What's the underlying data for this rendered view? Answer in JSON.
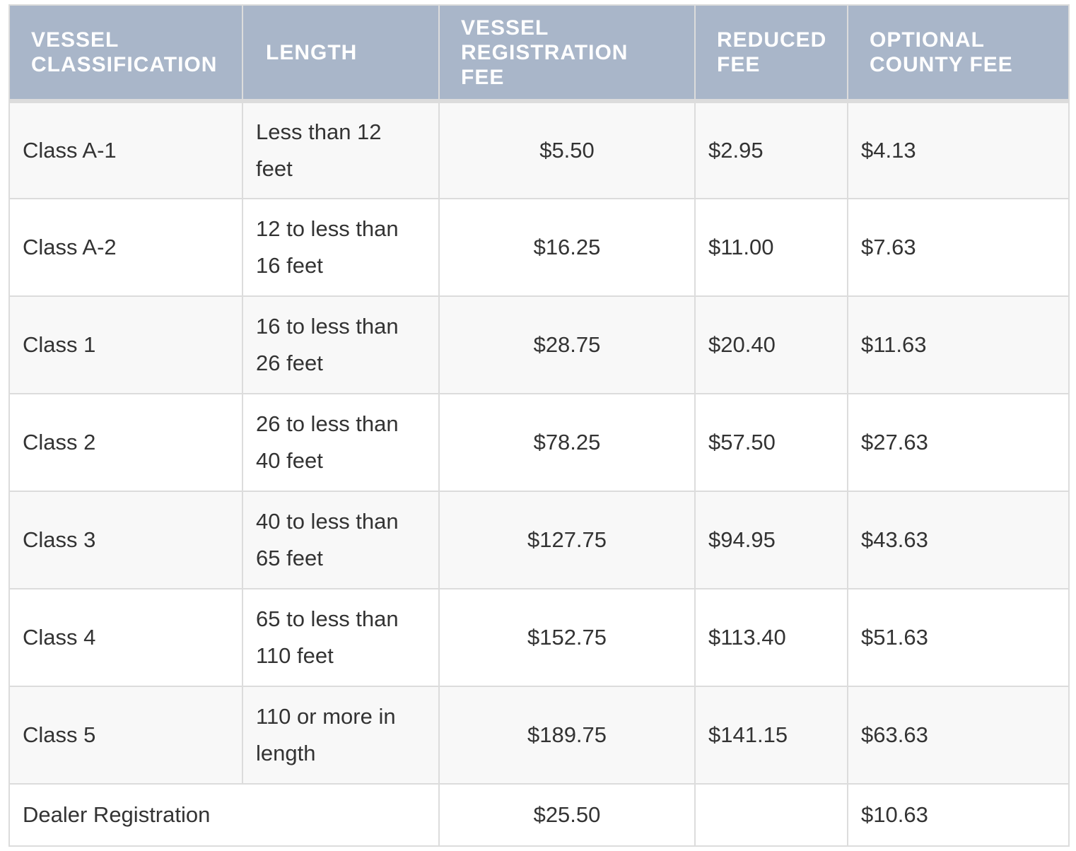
{
  "table": {
    "headers": {
      "classification": "VESSEL CLASSIFICATION",
      "length": "LENGTH",
      "registration_fee": "VESSEL REGISTRATION FEE",
      "reduced_fee": "REDUCED FEE",
      "county_fee": "OPTIONAL COUNTY FEE"
    },
    "rows": [
      {
        "classification": "Class A-1",
        "length": "Less than 12 feet",
        "registration_fee": "$5.50",
        "reduced_fee": "$2.95",
        "county_fee": "$4.13"
      },
      {
        "classification": "Class A-2",
        "length": "12 to less than 16 feet",
        "registration_fee": "$16.25",
        "reduced_fee": "$11.00",
        "county_fee": "$7.63"
      },
      {
        "classification": "Class 1",
        "length": "16 to less than 26 feet",
        "registration_fee": "$28.75",
        "reduced_fee": "$20.40",
        "county_fee": "$11.63"
      },
      {
        "classification": "Class 2",
        "length": "26 to less than 40 feet",
        "registration_fee": "$78.25",
        "reduced_fee": "$57.50",
        "county_fee": "$27.63"
      },
      {
        "classification": "Class 3",
        "length": "40 to less than 65 feet",
        "registration_fee": "$127.75",
        "reduced_fee": "$94.95",
        "county_fee": "$43.63"
      },
      {
        "classification": "Class 4",
        "length": "65 to less than 110 feet",
        "registration_fee": "$152.75",
        "reduced_fee": "$113.40",
        "county_fee": "$51.63"
      },
      {
        "classification": "Class 5",
        "length": "110 or more in length",
        "registration_fee": "$189.75",
        "reduced_fee": "$141.15",
        "county_fee": "$63.63"
      }
    ],
    "dealer": {
      "classification": "Dealer Registration",
      "registration_fee": "$25.50",
      "reduced_fee": "",
      "county_fee": "$10.63"
    }
  }
}
